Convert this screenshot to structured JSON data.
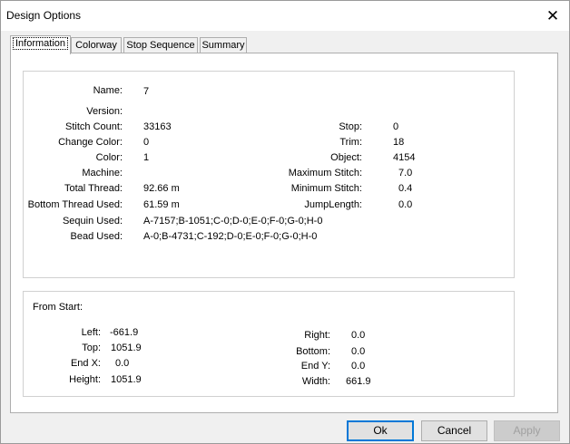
{
  "window": {
    "title": "Design Options",
    "close_glyph": "✕"
  },
  "tabs": [
    {
      "label": "Information",
      "active": true
    },
    {
      "label": "Colorway",
      "active": false
    },
    {
      "label": "Stop Sequence",
      "active": false
    },
    {
      "label": "Summary",
      "active": false
    }
  ],
  "info": {
    "name_label": "Name:",
    "name_value": "7",
    "version_label": "Version:",
    "version_value": "",
    "stitch_count_label": "Stitch Count:",
    "stitch_count_value": "33163",
    "change_color_label": "Change Color:",
    "change_color_value": "0",
    "color_label": "Color:",
    "color_value": "1",
    "machine_label": "Machine:",
    "machine_value": "",
    "total_thread_label": "Total Thread:",
    "total_thread_value": "92.66 m",
    "bottom_thread_label": "Bottom Thread Used:",
    "bottom_thread_value": "61.59 m",
    "sequin_label": "Sequin Used:",
    "sequin_value": "A-7157;B-1051;C-0;D-0;E-0;F-0;G-0;H-0",
    "bead_label": "Bead Used:",
    "bead_value": "A-0;B-4731;C-192;D-0;E-0;F-0;G-0;H-0",
    "stop_label": "Stop:",
    "stop_value": "0",
    "trim_label": "Trim:",
    "trim_value": "18",
    "object_label": "Object:",
    "object_value": "4154",
    "max_stitch_label": "Maximum Stitch:",
    "max_stitch_value": "7.0",
    "min_stitch_label": "Minimum Stitch:",
    "min_stitch_value": "0.4",
    "jump_length_label": "JumpLength:",
    "jump_length_value": "0.0"
  },
  "from_start": {
    "header": "From Start:",
    "left_label": "Left:",
    "left_value": "-661.9",
    "top_label": "Top:",
    "top_value": "1051.9",
    "end_x_label": "End X:",
    "end_x_value": "0.0",
    "height_label": "Height:",
    "height_value": "1051.9",
    "right_label": "Right:",
    "right_value": "0.0",
    "bottom_label": "Bottom:",
    "bottom_value": "0.0",
    "end_y_label": "End Y:",
    "end_y_value": "0.0",
    "width_label": "Width:",
    "width_value": "661.9"
  },
  "buttons": {
    "ok": "Ok",
    "cancel": "Cancel",
    "apply": "Apply"
  },
  "colors": {
    "accent": "#0078d7",
    "decor_green": "#3c8a2e"
  }
}
